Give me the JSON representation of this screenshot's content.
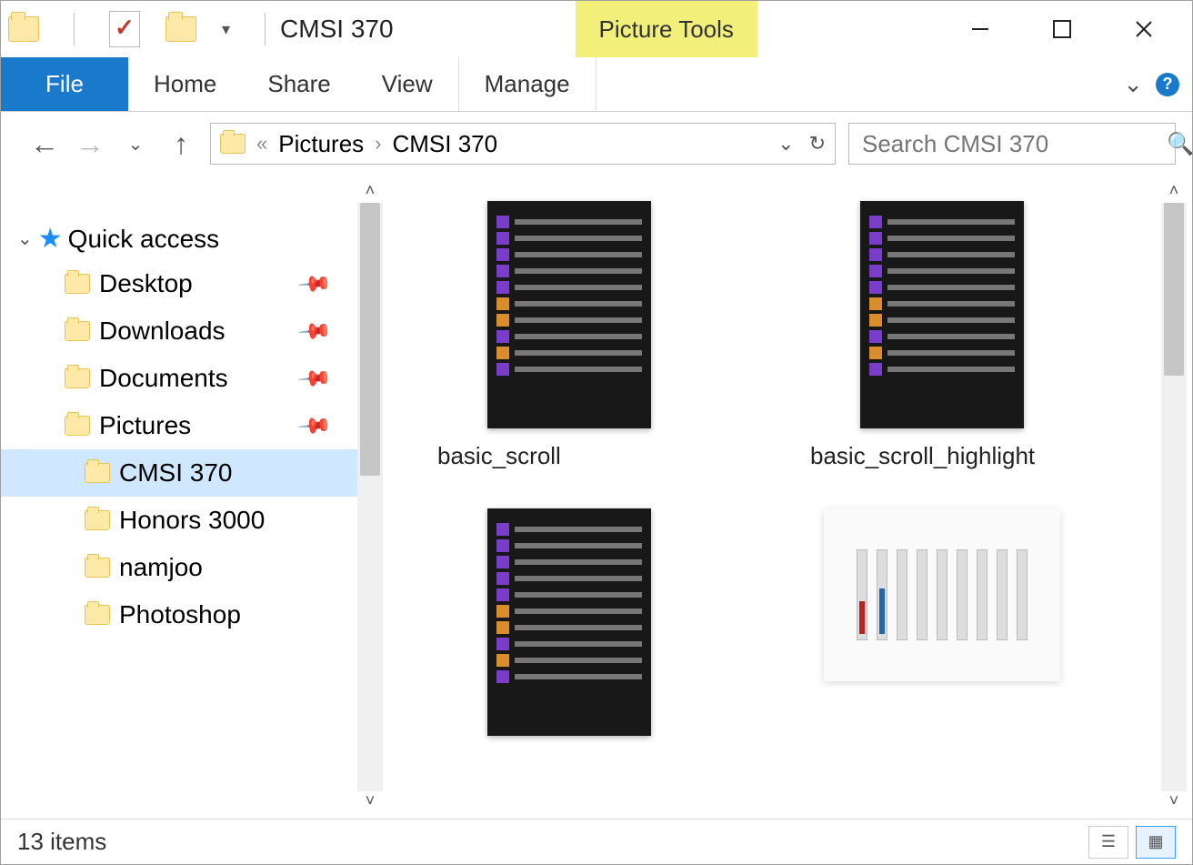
{
  "titlebar": {
    "window_title": "CMSI 370",
    "context_tab": "Picture Tools"
  },
  "ribbon": {
    "file": "File",
    "tabs": [
      "Home",
      "Share",
      "View"
    ],
    "context_tab": "Manage"
  },
  "address": {
    "crumbs": [
      "Pictures",
      "CMSI 370"
    ]
  },
  "search": {
    "placeholder": "Search CMSI 370"
  },
  "sidebar": {
    "root": "Quick access",
    "items": [
      {
        "label": "Desktop",
        "pinned": true,
        "selected": false,
        "sub": false
      },
      {
        "label": "Downloads",
        "pinned": true,
        "selected": false,
        "sub": false
      },
      {
        "label": "Documents",
        "pinned": true,
        "selected": false,
        "sub": false
      },
      {
        "label": "Pictures",
        "pinned": true,
        "selected": false,
        "sub": false
      },
      {
        "label": "CMSI 370",
        "pinned": false,
        "selected": true,
        "sub": true
      },
      {
        "label": "Honors 3000",
        "pinned": false,
        "selected": false,
        "sub": true
      },
      {
        "label": "namjoo",
        "pinned": false,
        "selected": false,
        "sub": true
      },
      {
        "label": "Photoshop",
        "pinned": false,
        "selected": false,
        "sub": true
      }
    ]
  },
  "files": [
    {
      "name": "basic_scroll",
      "kind": "dark"
    },
    {
      "name": "basic_scroll_highlight",
      "kind": "dark"
    },
    {
      "name": "",
      "kind": "dark"
    },
    {
      "name": "",
      "kind": "light"
    }
  ],
  "status": {
    "text": "13 items"
  }
}
